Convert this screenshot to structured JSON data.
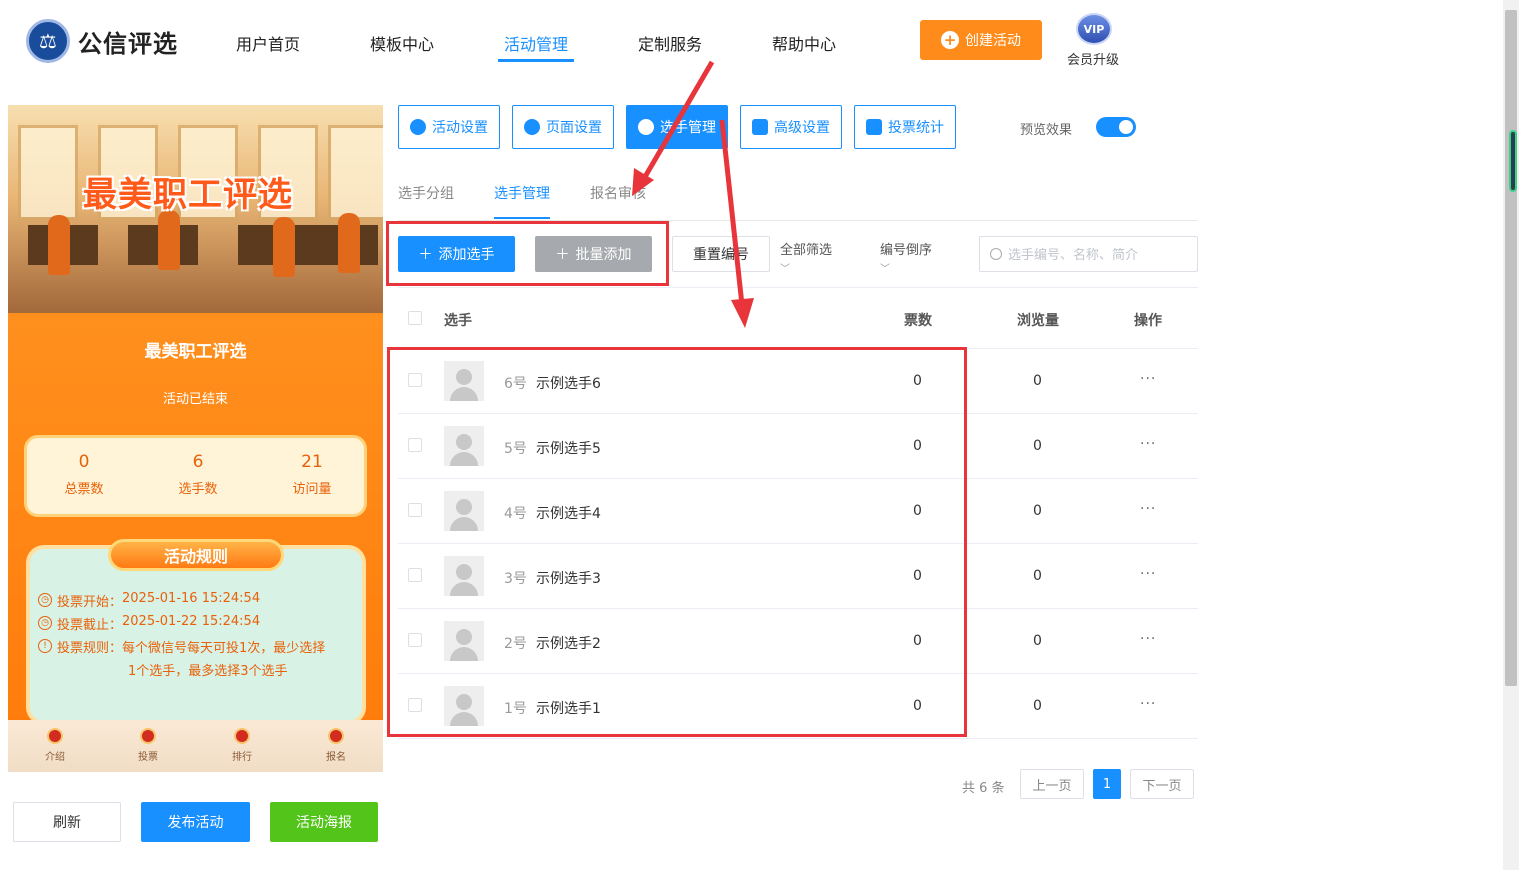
{
  "header": {
    "logo_text": "公信评选",
    "nav": [
      "用户首页",
      "模板中心",
      "活动管理",
      "定制服务",
      "帮助中心"
    ],
    "active_nav": "活动管理",
    "create_button": "创建活动",
    "vip_badge": "VIP",
    "vip_label": "会员升级"
  },
  "preview": {
    "banner_title": "最美职工评选",
    "title": "最美职工评选",
    "status": "活动已结束",
    "stats": [
      {
        "value": "0",
        "label": "总票数"
      },
      {
        "value": "6",
        "label": "选手数"
      },
      {
        "value": "21",
        "label": "访问量"
      }
    ],
    "rules_heading": "活动规则",
    "rules": [
      {
        "label": "投票开始：",
        "value": "2025-01-16 15:24:54"
      },
      {
        "label": "投票截止：",
        "value": "2025-01-22 15:24:54"
      },
      {
        "label": "投票规则：",
        "value": "每个微信号每天可投1次，最少选择",
        "value2": "1个选手，最多选择3个选手"
      }
    ],
    "tabs": [
      "介绍",
      "投票",
      "排行",
      "报名"
    ]
  },
  "actions": {
    "refresh": "刷新",
    "publish": "发布活动",
    "poster": "活动海报"
  },
  "settings_tabs": [
    "活动设置",
    "页面设置",
    "选手管理",
    "高级设置",
    "投票统计"
  ],
  "active_settings_tab": "选手管理",
  "preview_toggle_label": "预览效果",
  "preview_toggle_on": true,
  "sub_tabs": [
    "选手分组",
    "选手管理",
    "报名审核"
  ],
  "active_sub_tab": "选手管理",
  "toolbar": {
    "add": "添加选手",
    "batch_add": "批量添加",
    "reset_number": "重置编号",
    "filter_all": "全部筛选",
    "sort_number": "编号倒序",
    "search_placeholder": "选手编号、名称、简介"
  },
  "table": {
    "headers": [
      "选手",
      "票数",
      "浏览量",
      "操作"
    ],
    "rows": [
      {
        "number": "6号",
        "name": "示例选手6",
        "votes": "0",
        "views": "0",
        "op": "···"
      },
      {
        "number": "5号",
        "name": "示例选手5",
        "votes": "0",
        "views": "0",
        "op": "···"
      },
      {
        "number": "4号",
        "name": "示例选手4",
        "votes": "0",
        "views": "0",
        "op": "···"
      },
      {
        "number": "3号",
        "name": "示例选手3",
        "votes": "0",
        "views": "0",
        "op": "···"
      },
      {
        "number": "2号",
        "name": "示例选手2",
        "votes": "0",
        "views": "0",
        "op": "···"
      },
      {
        "number": "1号",
        "name": "示例选手1",
        "votes": "0",
        "views": "0",
        "op": "···"
      }
    ]
  },
  "pagination": {
    "total": "共 6 条",
    "prev": "上一页",
    "current": "1",
    "next": "下一页"
  },
  "colors": {
    "primary": "#1890ff",
    "orange": "#ff8c1a",
    "green": "#52c41a",
    "annotation": "#e8343b"
  }
}
